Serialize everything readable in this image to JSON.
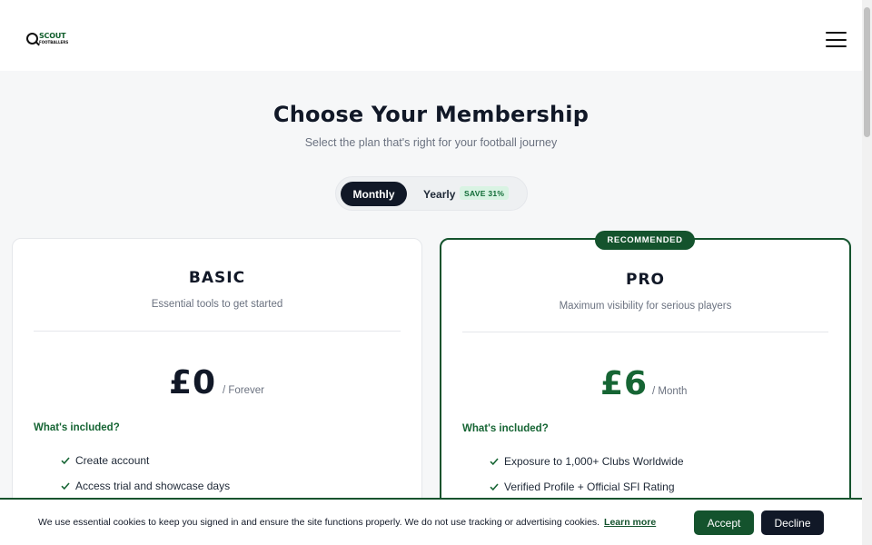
{
  "header": {
    "logo_main": "SCOUT",
    "logo_sub": "FOOTBALLERS",
    "menu_icon": "hamburger-menu-icon"
  },
  "hero": {
    "title": "Choose Your Membership",
    "subtitle": "Select the plan that's right for your football journey"
  },
  "billing_toggle": {
    "monthly_label": "Monthly",
    "yearly_label": "Yearly",
    "save_badge": "SAVE 31%",
    "selected": "Monthly"
  },
  "plans": [
    {
      "name": "BASIC",
      "description": "Essential tools to get started",
      "price": "£0",
      "period": "/ Forever",
      "included_label": "What's included?",
      "features": [
        "Create account",
        "Access trial and showcase days"
      ]
    },
    {
      "badge": "RECOMMENDED",
      "name": "PRO",
      "description": "Maximum visibility for serious players",
      "price": "£6",
      "period": "/ Month",
      "included_label": "What's included?",
      "features": [
        "Exposure to 1,000+ Clubs Worldwide",
        "Verified Profile + Official SFI Rating"
      ]
    }
  ],
  "cookie_banner": {
    "text": "We use essential cookies to keep you signed in and ensure the site functions properly. We do not use tracking or advertising cookies.",
    "link_label": "Learn more",
    "accept_label": "Accept",
    "decline_label": "Decline"
  },
  "colors": {
    "brand_green": "#14532d",
    "dark": "#111827",
    "price_green": "#166534"
  }
}
